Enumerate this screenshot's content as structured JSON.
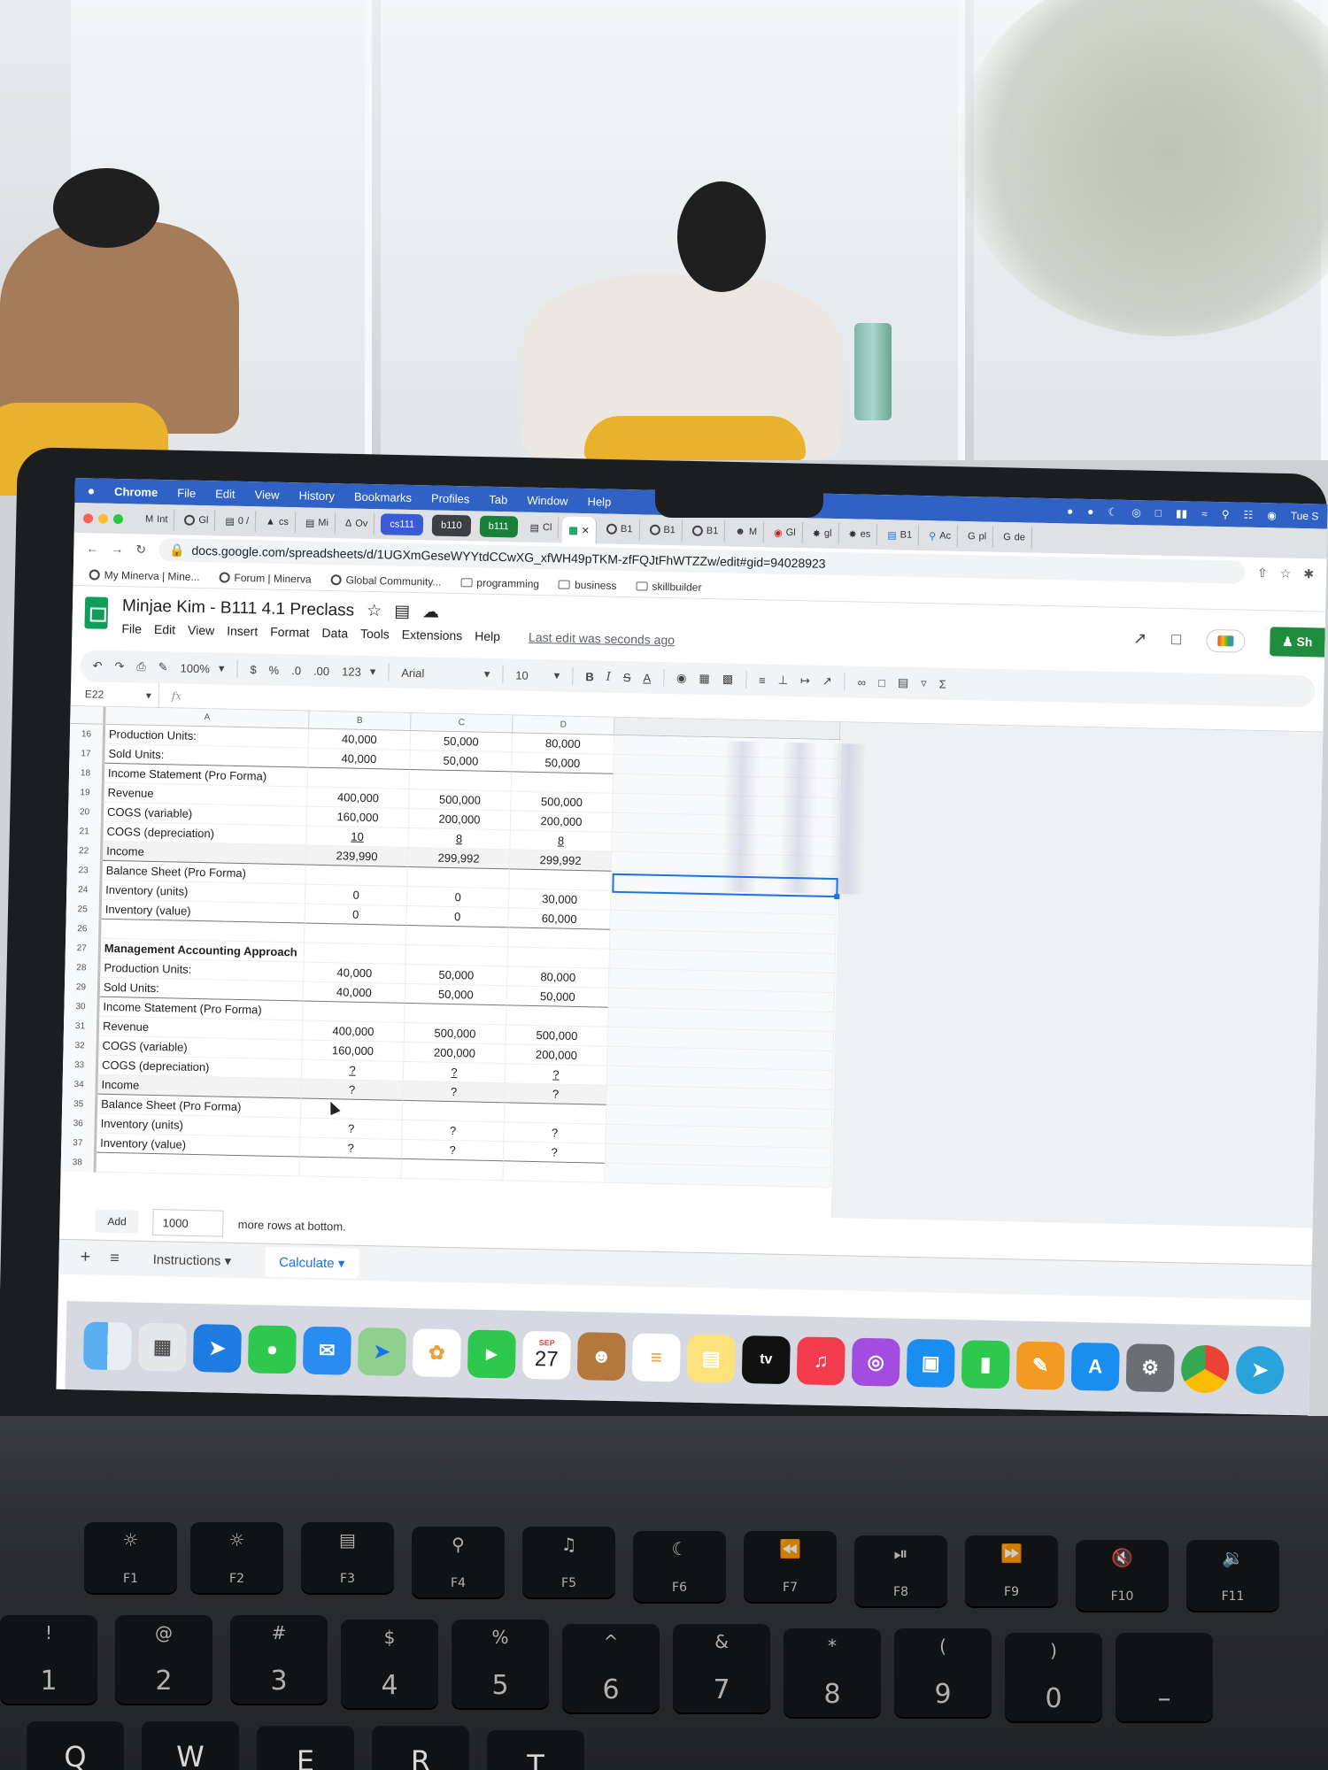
{
  "menubar": {
    "app": "Chrome",
    "items": [
      "File",
      "Edit",
      "View",
      "History",
      "Bookmarks",
      "Profiles",
      "Tab",
      "Window",
      "Help"
    ],
    "clock": "Tue S"
  },
  "tabs": {
    "items": [
      "Int",
      "Gl",
      "0 /",
      "cs",
      "Mi",
      "Ov"
    ],
    "pills": [
      "cs111",
      "b110",
      "b111"
    ],
    "active_prefix": "Cl",
    "after": [
      "B1",
      "B1",
      "B1",
      "M",
      "Gl",
      "gl",
      "es",
      "B1",
      "Ac",
      "pl",
      "de"
    ]
  },
  "address": {
    "url": "docs.google.com/spreadsheets/d/1UGXmGeseWYYtdCCwXG_xfWH49pTKM-zfFQJtFhWTZZw/edit#gid=94028923"
  },
  "bookmarks": [
    "My Minerva | Mine...",
    "Forum | Minerva",
    "Global Community...",
    "programming",
    "business",
    "skillbuilder"
  ],
  "doc": {
    "title": "Minjae Kim - B111 4.1 Preclass",
    "menus": [
      "File",
      "Edit",
      "View",
      "Insert",
      "Format",
      "Data",
      "Tools",
      "Extensions",
      "Help"
    ],
    "last_edit": "Last edit was seconds ago",
    "share_label": "Sh"
  },
  "toolbar": {
    "zoom": "100%",
    "currency": "$",
    "percent": "%",
    "dec_less": ".0",
    "dec_more": ".00",
    "format_more": "123",
    "font": "Arial",
    "font_size": "10",
    "bold": "B",
    "italic": "I",
    "strike": "S",
    "text_color": "A"
  },
  "formula_bar": {
    "cell": "E22",
    "fx": "fx"
  },
  "grid": {
    "columns": [
      "A",
      "B",
      "C",
      "D"
    ],
    "rows": [
      {
        "n": "16",
        "a": "Production Units:",
        "b": "40,000",
        "c": "50,000",
        "d": "80,000"
      },
      {
        "n": "17",
        "a": "Sold Units:",
        "b": "40,000",
        "c": "50,000",
        "d": "50,000",
        "line": true
      },
      {
        "n": "18",
        "a": "Income Statement (Pro Forma)",
        "b": "",
        "c": "",
        "d": ""
      },
      {
        "n": "19",
        "a": "Revenue",
        "b": "400,000",
        "c": "500,000",
        "d": "500,000"
      },
      {
        "n": "20",
        "a": "COGS (variable)",
        "b": "160,000",
        "c": "200,000",
        "d": "200,000"
      },
      {
        "n": "21",
        "a": "COGS (depreciation)",
        "b": "10",
        "c": "8",
        "d": "8",
        "ul": true
      },
      {
        "n": "22",
        "a": "Income",
        "b": "239,990",
        "c": "299,992",
        "d": "299,992",
        "line": true,
        "shade": true
      },
      {
        "n": "23",
        "a": "Balance Sheet (Pro Forma)",
        "b": "",
        "c": "",
        "d": ""
      },
      {
        "n": "24",
        "a": "Inventory (units)",
        "b": "0",
        "c": "0",
        "d": "30,000"
      },
      {
        "n": "25",
        "a": "Inventory (value)",
        "b": "0",
        "c": "0",
        "d": "60,000",
        "line": true
      },
      {
        "n": "26",
        "a": "",
        "b": "",
        "c": "",
        "d": ""
      },
      {
        "n": "27",
        "a": "Management Accounting Approach",
        "b": "",
        "c": "",
        "d": "",
        "sect": true
      },
      {
        "n": "28",
        "a": "Production Units:",
        "b": "40,000",
        "c": "50,000",
        "d": "80,000"
      },
      {
        "n": "29",
        "a": "Sold Units:",
        "b": "40,000",
        "c": "50,000",
        "d": "50,000",
        "line": true
      },
      {
        "n": "30",
        "a": "Income Statement (Pro Forma)",
        "b": "",
        "c": "",
        "d": ""
      },
      {
        "n": "31",
        "a": "Revenue",
        "b": "400,000",
        "c": "500,000",
        "d": "500,000"
      },
      {
        "n": "32",
        "a": "COGS (variable)",
        "b": "160,000",
        "c": "200,000",
        "d": "200,000"
      },
      {
        "n": "33",
        "a": "COGS (depreciation)",
        "b": "?",
        "c": "?",
        "d": "?",
        "ul": true
      },
      {
        "n": "34",
        "a": "Income",
        "b": "?",
        "c": "?",
        "d": "?",
        "line": true,
        "shade": true
      },
      {
        "n": "35",
        "a": "Balance Sheet (Pro Forma)",
        "b": "",
        "c": "",
        "d": ""
      },
      {
        "n": "36",
        "a": "Inventory (units)",
        "b": "?",
        "c": "?",
        "d": "?"
      },
      {
        "n": "37",
        "a": "Inventory (value)",
        "b": "?",
        "c": "?",
        "d": "?",
        "line": true
      },
      {
        "n": "38",
        "a": "",
        "b": "",
        "c": "",
        "d": ""
      }
    ]
  },
  "add_rows": {
    "button": "Add",
    "count": "1000",
    "suffix": "more rows at bottom."
  },
  "sheet_tabs": [
    "Instructions",
    "Calculate"
  ],
  "dock": {
    "calendar_month": "SEP",
    "calendar_day": "27",
    "tv_label": "tv"
  },
  "keyboard": {
    "fn_row": [
      "F1",
      "F2",
      "F3",
      "F4",
      "F5",
      "F6",
      "F7",
      "F8",
      "F9",
      "F10",
      "F11"
    ],
    "num_row": [
      "1",
      "2",
      "3",
      "4",
      "5",
      "6",
      "7",
      "8",
      "9",
      "0"
    ],
    "num_row_shift": [
      "!",
      "@",
      "#",
      "$",
      "%",
      "^",
      "&",
      "*",
      "(",
      ")"
    ],
    "letters": [
      "Q",
      "W",
      "E",
      "R",
      "T"
    ]
  },
  "colors": {
    "menubar": "#2f62c4",
    "sheets_green": "#0f9d58",
    "selection": "#1a73e8"
  }
}
